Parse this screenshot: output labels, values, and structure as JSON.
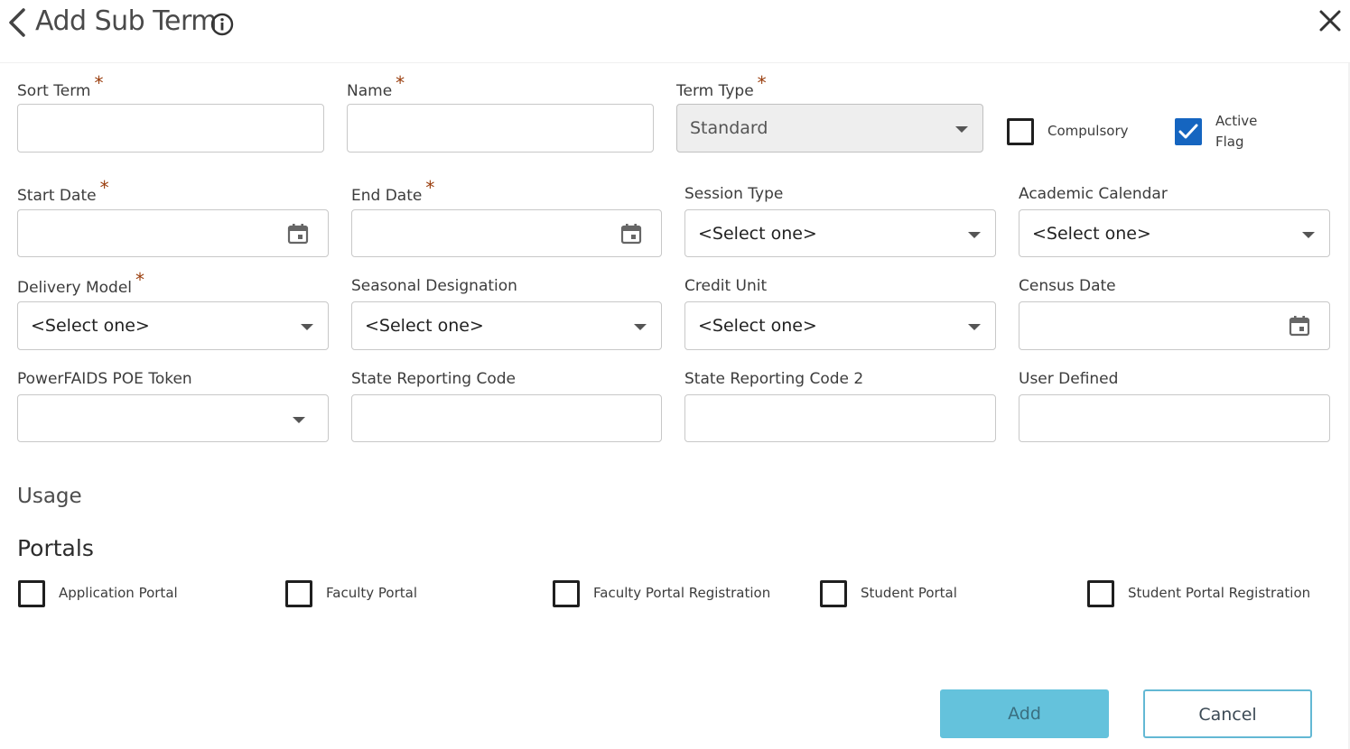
{
  "header": {
    "title": "Add Sub Term"
  },
  "required_marker": "*",
  "fields": {
    "sort_term": {
      "label": "Sort Term",
      "value": ""
    },
    "name": {
      "label": "Name",
      "value": ""
    },
    "term_type": {
      "label": "Term Type",
      "value": "Standard"
    },
    "start_date": {
      "label": "Start Date",
      "value": ""
    },
    "end_date": {
      "label": "End Date",
      "value": ""
    },
    "session_type": {
      "label": "Session Type",
      "value": "<Select one>"
    },
    "academic_calendar": {
      "label": "Academic Calendar",
      "value": "<Select one>"
    },
    "delivery_model": {
      "label": "Delivery Model",
      "value": "<Select one>"
    },
    "seasonal_designation": {
      "label": "Seasonal Designation",
      "value": "<Select one>"
    },
    "credit_unit": {
      "label": "Credit Unit",
      "value": "<Select one>"
    },
    "census_date": {
      "label": "Census Date",
      "value": ""
    },
    "powerfaids_poe_token": {
      "label": "PowerFAIDS POE Token",
      "value": ""
    },
    "state_reporting_code": {
      "label": "State Reporting Code",
      "value": ""
    },
    "state_reporting_code_2": {
      "label": "State Reporting Code 2",
      "value": ""
    },
    "user_defined": {
      "label": "User Defined",
      "value": ""
    }
  },
  "flags": {
    "compulsory": {
      "label": "Compulsory",
      "checked": false
    },
    "active_flag": {
      "label_line1": "Active",
      "label_line2": "Flag",
      "checked": true
    }
  },
  "sections": {
    "usage": "Usage",
    "portals": "Portals"
  },
  "portals": [
    {
      "label": "Application Portal",
      "checked": false
    },
    {
      "label": "Faculty Portal",
      "checked": false
    },
    {
      "label": "Faculty Portal Registration",
      "checked": false
    },
    {
      "label": "Student Portal",
      "checked": false
    },
    {
      "label": "Student Portal Registration",
      "checked": false
    }
  ],
  "buttons": {
    "add": "Add",
    "cancel": "Cancel"
  },
  "colors": {
    "accent": "#64c2dc",
    "required": "#9a3e0e",
    "checkbox_checked": "#1565c0"
  }
}
